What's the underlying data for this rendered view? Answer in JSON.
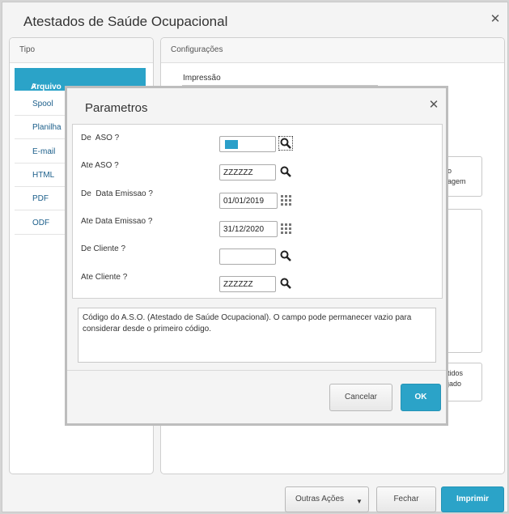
{
  "window": {
    "title": "Atestados de Saúde Ocupacional"
  },
  "tipo": {
    "header": "Tipo",
    "items": [
      {
        "label": "Arquivo",
        "selected": true
      },
      {
        "label": "Spool"
      },
      {
        "label": "Planilha"
      },
      {
        "label": "E-mail"
      },
      {
        "label": "HTML"
      },
      {
        "label": "PDF"
      },
      {
        "label": "ODF"
      }
    ]
  },
  "config": {
    "header": "Configurações",
    "impressao": "Impressão",
    "frag1a": "o",
    "frag1b": "agem",
    "frag2a": "tidos",
    "frag2b": "jado"
  },
  "footer": {
    "outras": "Outras Ações",
    "fechar": "Fechar",
    "imprimir": "Imprimir"
  },
  "modal": {
    "title": "Parametros",
    "fields": [
      {
        "label": "De  ASO ?",
        "value": ""
      },
      {
        "label": "Ate ASO ?",
        "value": "ZZZZZZ"
      },
      {
        "label": "De  Data Emissao ?",
        "value": "01/01/2019"
      },
      {
        "label": "Ate Data Emissao ?",
        "value": "31/12/2020"
      },
      {
        "label": "De Cliente ?",
        "value": ""
      },
      {
        "label": "Ate Cliente ?",
        "value": "ZZZZZZ"
      }
    ],
    "help": "Código do A.S.O. (Atestado de Saúde Ocupacional). O campo pode permanecer vazio para considerar desde o primeiro código.",
    "cancel": "Cancelar",
    "ok": "OK"
  },
  "colors": {
    "accent": "#2ba3c8",
    "link": "#1b5e8a",
    "highlight": "#2b9fc9"
  },
  "icons": [
    "close-icon",
    "check-icon",
    "search-icon",
    "calendar-icon",
    "chevron-down-icon"
  ]
}
